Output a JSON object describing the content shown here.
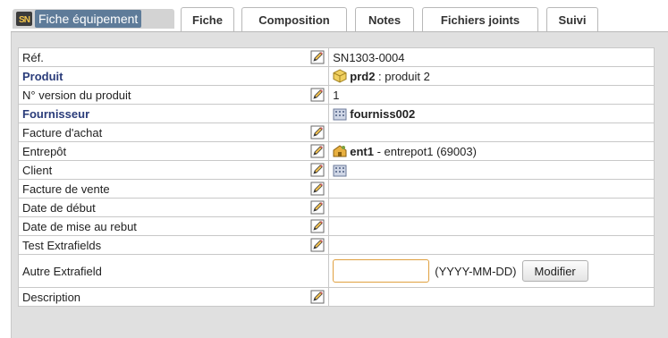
{
  "tabs": {
    "title_tab": "Fiche équipement",
    "items": [
      "Fiche",
      "Composition",
      "Notes",
      "Fichiers joints",
      "Suivi"
    ]
  },
  "rows": {
    "ref": {
      "label": "Réf.",
      "value": "SN1303-0004"
    },
    "produit": {
      "label": "Produit",
      "code": "prd2",
      "name": " : produit 2"
    },
    "version": {
      "label": "N° version du produit",
      "value": "1"
    },
    "fournisseur": {
      "label": "Fournisseur",
      "code": "fourniss002"
    },
    "facture_achat": {
      "label": "Facture d'achat"
    },
    "entrepot": {
      "label": "Entrepôt",
      "code": "ent1",
      "name": " - entrepot1 (69003)"
    },
    "client": {
      "label": "Client"
    },
    "facture_vente": {
      "label": "Facture de vente"
    },
    "date_debut": {
      "label": "Date de début"
    },
    "date_rebut": {
      "label": "Date de mise au rebut"
    },
    "test_extra": {
      "label": "Test Extrafields"
    },
    "autre_extra": {
      "label": "Autre Extrafield",
      "value": "",
      "hint": "(YYYY-MM-DD)",
      "button": "Modifier"
    },
    "description": {
      "label": "Description"
    }
  },
  "colors": {
    "title_tab_bg": "#5e7b99",
    "label_strong": "#2a3c7a",
    "frame_bg": "#e0e0e0",
    "input_border": "#e0a040"
  },
  "icons": [
    "equipment-logo-icon",
    "edit-pencil-icon",
    "product-icon",
    "supplier-company-icon",
    "warehouse-icon",
    "company-icon"
  ]
}
